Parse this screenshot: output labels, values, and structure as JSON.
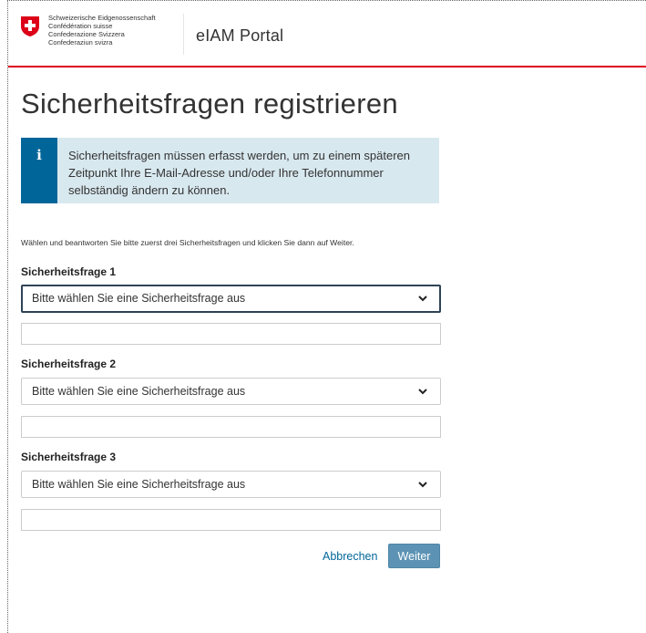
{
  "header": {
    "federal_names": [
      "Schweizerische Eidgenossenschaft",
      "Confédération suisse",
      "Confederazione Svizzera",
      "Confederaziun svizra"
    ],
    "portal_title": "eIAM Portal",
    "brand_color": "#dc0018"
  },
  "page": {
    "title": "Sicherheitsfragen registrieren",
    "info_text": "Sicherheitsfragen müssen erfasst werden, um zu einem späteren Zeitpunkt Ihre E-Mail-Adresse und/oder Ihre Telefonnummer selbständig ändern zu können.",
    "info_icon": "info-icon",
    "info_color": "#006699",
    "instruction": "Wählen und beantworten Sie bitte zuerst drei Sicherheitsfragen und klicken Sie dann auf Weiter."
  },
  "questions": [
    {
      "label": "Sicherheitsfrage 1",
      "selected": "Bitte wählen Sie eine Sicherheitsfrage aus",
      "answer": ""
    },
    {
      "label": "Sicherheitsfrage 2",
      "selected": "Bitte wählen Sie eine Sicherheitsfrage aus",
      "answer": ""
    },
    {
      "label": "Sicherheitsfrage 3",
      "selected": "Bitte wählen Sie eine Sicherheitsfrage aus",
      "answer": ""
    }
  ],
  "actions": {
    "cancel_label": "Abbrechen",
    "next_label": "Weiter",
    "next_color": "#5c93b4"
  }
}
